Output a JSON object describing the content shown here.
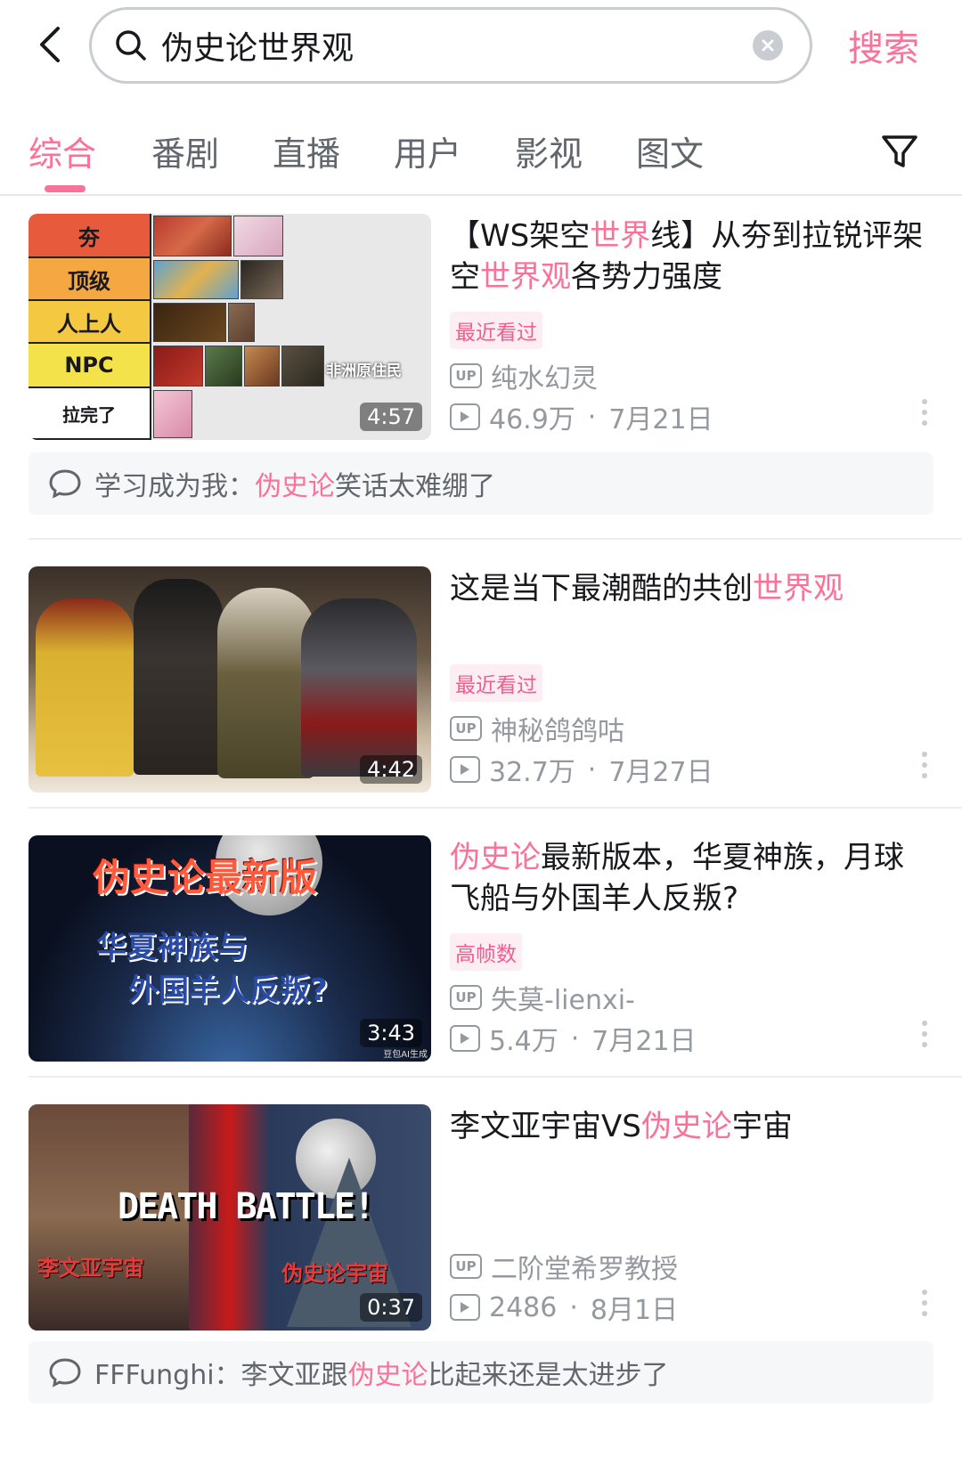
{
  "header": {
    "query": "伪史论世界观",
    "search_label": "搜索"
  },
  "tabs": [
    "综合",
    "番剧",
    "直播",
    "用户",
    "影视",
    "图文"
  ],
  "results": [
    {
      "title_parts": [
        {
          "text": "【WS架空",
          "hl": false
        },
        {
          "text": "世界",
          "hl": true
        },
        {
          "text": "线】从夯到拉锐评架空",
          "hl": false
        },
        {
          "text": "世界观",
          "hl": true
        },
        {
          "text": "各势力强度",
          "hl": false
        }
      ],
      "badge": "最近看过",
      "uploader": "纯水幻灵",
      "views": "46.9万",
      "date": "7月21日",
      "duration": "4:57",
      "thumb": {
        "tiers": [
          "夯",
          "顶级",
          "人上人",
          "NPC",
          "拉完了"
        ],
        "caption": "非洲原住民"
      },
      "comment": {
        "user": "学习成为我：",
        "parts": [
          {
            "text": "伪史论",
            "hl": true
          },
          {
            "text": "笑话太难绷了",
            "hl": false
          }
        ]
      }
    },
    {
      "title_parts": [
        {
          "text": "这是当下最潮酷的共创",
          "hl": false
        },
        {
          "text": "世界观",
          "hl": true
        }
      ],
      "badge": "最近看过",
      "uploader": "神秘鸽鸽咕",
      "views": "32.7万",
      "date": "7月27日",
      "duration": "4:42"
    },
    {
      "title_parts": [
        {
          "text": "伪史论",
          "hl": true
        },
        {
          "text": "最新版本，华夏神族，月球飞船与外国羊人反叛?",
          "hl": false
        }
      ],
      "badge": "高帧数",
      "uploader": "失莫-lienxi-",
      "views": "5.4万",
      "date": "7月21日",
      "duration": "3:43",
      "thumb": {
        "line1": "伪史论最新版",
        "line2": "华夏神族与",
        "line3": "外国羊人反叛?",
        "mark": "豆包AI生成"
      }
    },
    {
      "title_parts": [
        {
          "text": "李文亚宇宙VS",
          "hl": false
        },
        {
          "text": "伪史论",
          "hl": true
        },
        {
          "text": "宇宙",
          "hl": false
        }
      ],
      "uploader": "二阶堂希罗教授",
      "views": "2486",
      "date": "8月1日",
      "duration": "0:37",
      "thumb": {
        "center": "DEATH BATTLE!",
        "left": "李文亚宇宙",
        "right": "伪史论宇宙"
      },
      "comment": {
        "user": "FFFunghi：",
        "parts": [
          {
            "text": "李文亚跟",
            "hl": false
          },
          {
            "text": "伪史论",
            "hl": true
          },
          {
            "text": "比起来还是太进步了",
            "hl": false
          }
        ]
      }
    }
  ],
  "colors": {
    "accent": "#fb7299",
    "text": "#18191c",
    "secondary": "#9499a0"
  }
}
